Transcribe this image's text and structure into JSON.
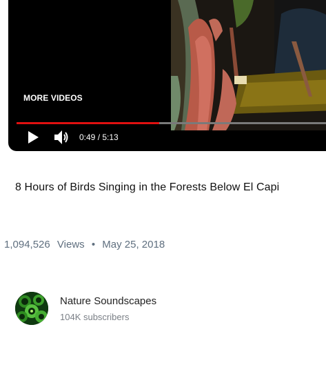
{
  "player": {
    "more_videos_label": "MORE VIDEOS",
    "time_display": "0:49 / 5:13",
    "progress_fraction": 0.45,
    "progress_color": "#e01010",
    "icons": {
      "play": "play-icon",
      "volume": "volume-icon"
    }
  },
  "video": {
    "title": "8 Hours of Birds Singing in the Forests Below El Capi",
    "views": "1,094,526",
    "views_label": "Views",
    "separator": "•",
    "date": "May 25, 2018"
  },
  "channel": {
    "name": "Nature Soundscapes",
    "subscribers": "104K subscribers"
  }
}
